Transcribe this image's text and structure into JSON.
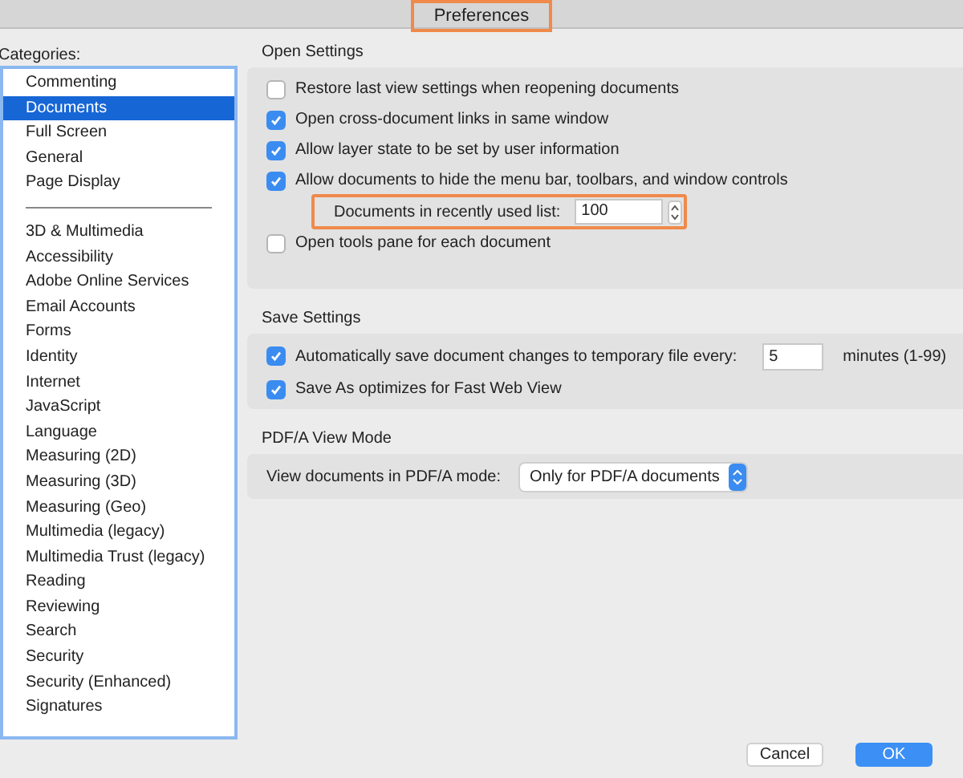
{
  "window": {
    "title": "Preferences"
  },
  "categories": {
    "label": "Categories:",
    "items": [
      {
        "label": "Commenting",
        "selected": false
      },
      {
        "label": "Documents",
        "selected": true
      },
      {
        "label": "Full Screen",
        "selected": false
      },
      {
        "label": "General",
        "selected": false
      },
      {
        "label": "Page Display",
        "selected": false
      },
      {
        "kind": "divider"
      },
      {
        "label": "3D & Multimedia",
        "selected": false
      },
      {
        "label": "Accessibility",
        "selected": false
      },
      {
        "label": "Adobe Online Services",
        "selected": false
      },
      {
        "label": "Email Accounts",
        "selected": false
      },
      {
        "label": "Forms",
        "selected": false
      },
      {
        "label": "Identity",
        "selected": false
      },
      {
        "label": "Internet",
        "selected": false
      },
      {
        "label": "JavaScript",
        "selected": false
      },
      {
        "label": "Language",
        "selected": false
      },
      {
        "label": "Measuring (2D)",
        "selected": false
      },
      {
        "label": "Measuring (3D)",
        "selected": false
      },
      {
        "label": "Measuring (Geo)",
        "selected": false
      },
      {
        "label": "Multimedia (legacy)",
        "selected": false
      },
      {
        "label": "Multimedia Trust (legacy)",
        "selected": false
      },
      {
        "label": "Reading",
        "selected": false
      },
      {
        "label": "Reviewing",
        "selected": false
      },
      {
        "label": "Search",
        "selected": false
      },
      {
        "label": "Security",
        "selected": false
      },
      {
        "label": "Security (Enhanced)",
        "selected": false
      },
      {
        "label": "Signatures",
        "selected": false
      }
    ]
  },
  "sections": [
    {
      "title": "Open Settings",
      "rows": [
        {
          "kind": "checkbox",
          "label": "Restore last view settings when reopening documents",
          "checked": false
        },
        {
          "kind": "checkbox",
          "label": "Open cross-document links in same window",
          "checked": true
        },
        {
          "kind": "checkbox",
          "label": "Allow layer state to be set by user information",
          "checked": true
        },
        {
          "kind": "checkbox",
          "label": "Allow documents to hide the menu bar, toolbars, and window controls",
          "checked": true
        },
        {
          "kind": "stepper",
          "label": "Documents in recently used list:",
          "value": "100"
        },
        {
          "kind": "checkbox",
          "label": "Open tools pane for each document",
          "checked": false
        }
      ]
    },
    {
      "title": "Save Settings",
      "rows": [
        {
          "kind": "checkbox_field",
          "label": "Automatically save document changes to temporary file every:",
          "checked": true,
          "value": "5",
          "suffix": "minutes (1-99)"
        },
        {
          "kind": "checkbox",
          "label": "Save As optimizes for Fast Web View",
          "checked": true
        }
      ]
    },
    {
      "title": "PDF/A View Mode",
      "rows": [
        {
          "kind": "select",
          "label": "View documents in PDF/A mode:",
          "value": "Only for PDF/A documents"
        }
      ]
    }
  ],
  "buttons": [
    {
      "label": "Cancel",
      "kind": "secondary"
    },
    {
      "label": "OK",
      "kind": "primary"
    }
  ]
}
